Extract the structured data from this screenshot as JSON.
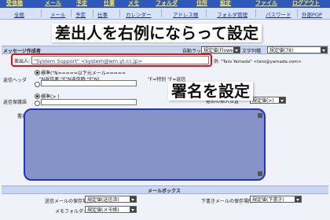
{
  "nav_primary": [
    "受信箱",
    "メール",
    "予定",
    "仕事",
    "メモ",
    "フォルダ",
    "住所",
    "設定",
    "ファイル",
    "ログアウト"
  ],
  "nav_secondary": [
    "全般",
    "メール",
    "予定",
    "仕事",
    "カレンダー",
    "アドレス帳",
    "フォルダ管理",
    "パスワード",
    "外部POP"
  ],
  "compose": {
    "header": "メッセージ作成者",
    "auto_wrap_label": "自動ラップ",
    "auto_wrap_value": "規定値(Flowed)",
    "charset_label": "文字列種",
    "charset_value": "規定値(78)",
    "sender_label": "差出人:",
    "sender_value": "\"System Support\" <system@wm.yt.cc.jp>",
    "sender_example": "例: \"Taro Yamada\" <taro@yamada.com>",
    "reply_header_label": "返信ヘッダ",
    "reply_opt1": "標準(\"N=====以下元メール=====",
    "reply_opt1b": "\"N返信者:\"F\"N返信時:\"F\"N)",
    "reply_right": "\"F=特別 \"F=返信",
    "forward_label": "返信保護語",
    "forward_opt": "標準(> )",
    "quote_select": "規定値(>)",
    "signature_label": "署名:",
    "signature_insert_label": "署名の挿入位置"
  },
  "callouts": {
    "top": "差出人を右例にならって設定",
    "signature": "署名を設定"
  },
  "mailbox": {
    "header": "メールボックス",
    "sent_label": "送信メールの保存場所:",
    "sent_value": "規定値(送信済)",
    "draft_label": "下書きメールの保存場所:",
    "draft_value": "規定値(下書き)",
    "memo_label": "メモフォルダ:",
    "memo_value": "規定値(メモ帳)"
  },
  "colors": {
    "highlight": "#e81010",
    "signature_border": "#2233cc",
    "signature_bg": "#8593c9"
  }
}
